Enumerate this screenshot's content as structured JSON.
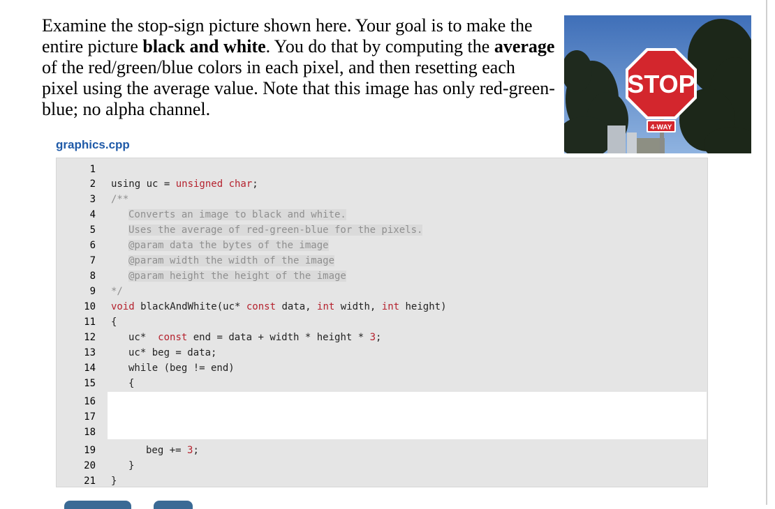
{
  "prompt": {
    "line1": "Examine the stop-sign picture shown here. Your goal is to make the",
    "line2_pre": "entire picture ",
    "line2_bold1": "black and white",
    "line2_mid": ". You do that by computing the ",
    "line2_bold2": "average",
    "line3": "of the red/green/blue colors in each pixel, and then resetting each",
    "line4": "pixel using the average value. Note that this image has only red-green-",
    "line5": "blue; no alpha channel."
  },
  "filename": "graphics.cpp",
  "photo": {
    "sign_text": "STOP",
    "plate_text": "4-WAY"
  },
  "line_numbers": [
    "1",
    "2",
    "3",
    "4",
    "5",
    "6",
    "7",
    "8",
    "9",
    "10",
    "11",
    "12",
    "13",
    "14",
    "15",
    "16",
    "17",
    "18",
    "19",
    "20",
    "21"
  ],
  "code": {
    "l2_a": "using uc = ",
    "l2_b": "unsigned char",
    "l2_c": ";",
    "l3": "/**",
    "l4": "Converts an image to black and white.",
    "l5": "Uses the average of red-green-blue for the pixels.",
    "l6": "@param data the bytes of the image",
    "l7": "@param width the width of the image",
    "l8": "@param height the height of the image",
    "l9": "*/",
    "l10_a": "void",
    "l10_b": " blackAndWhite(uc* ",
    "l10_c": "const",
    "l10_d": " data, ",
    "l10_e": "int",
    "l10_f": " width, ",
    "l10_g": "int",
    "l10_h": " height)",
    "l11": "{",
    "l12_a": "uc*  ",
    "l12_b": "const",
    "l12_c": " end = data + width * height * ",
    "l12_d": "3",
    "l12_e": ";",
    "l13": "uc* beg = data;",
    "l14": "while (beg != end)",
    "l15": "{",
    "l19_a": "beg += ",
    "l19_b": "3",
    "l19_c": ";",
    "l20": "}",
    "l21": "}"
  },
  "colors": {
    "keyword": "#b5222e",
    "comment": "#8f8f8f",
    "filename": "#1f5aa8",
    "editor_bg": "#e5e5e5"
  }
}
